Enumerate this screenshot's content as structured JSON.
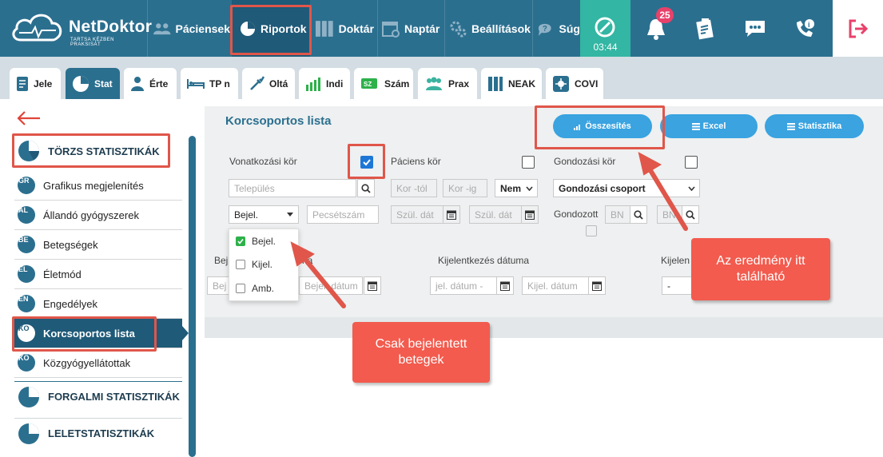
{
  "app": {
    "logo_name": "NetDoktor",
    "logo_tagline": "TARTSA KÉZBEN PRAKSISÁT"
  },
  "nav": {
    "items": [
      {
        "label": "Páciensek",
        "icon": "users-icon"
      },
      {
        "label": "Riportok",
        "icon": "pie-chart-icon"
      },
      {
        "label": "Doktár",
        "icon": "binders-icon"
      },
      {
        "label": "Naptár",
        "icon": "calendar-icon"
      },
      {
        "label": "Beállítások",
        "icon": "gears-icon"
      },
      {
        "label": "Súg",
        "icon": "help-icon"
      }
    ],
    "timer": "03:44",
    "notification_count": "25"
  },
  "tabs": [
    {
      "label": "Jele"
    },
    {
      "label": "Stat"
    },
    {
      "label": "Érte"
    },
    {
      "label": "TP n"
    },
    {
      "label": "Oltá"
    },
    {
      "label": "Indi"
    },
    {
      "label": "Szám"
    },
    {
      "label": "Prax"
    },
    {
      "label": "NEAK"
    },
    {
      "label": "COVI"
    }
  ],
  "sidebar": {
    "section_main": "TÖRZS STATISZTIKÁK",
    "items": [
      {
        "code": "GR",
        "label": "Grafikus megjelenítés"
      },
      {
        "code": "ÁL",
        "label": "Állandó gyógyszerek"
      },
      {
        "code": "BE",
        "label": "Betegségek"
      },
      {
        "code": "ÉL",
        "label": "Életmód"
      },
      {
        "code": "EN",
        "label": "Engedélyek"
      },
      {
        "code": "KO",
        "label": "Korcsoportos lista"
      },
      {
        "code": "KÖ",
        "label": "Közgyógyellátottak"
      }
    ],
    "section_2": "FORGALMI STATISZTIKÁK",
    "section_3": "LELETSTATISZTIKÁK"
  },
  "main": {
    "title": "Korcsoportos lista",
    "btn_summary": "Összesítés",
    "btn_excel": "Excel",
    "btn_stats": "Statisztika",
    "lbl_vonatkozasi": "Vonatkozási kör",
    "lbl_paciens": "Páciens kör",
    "lbl_gondozasi": "Gondozási kör",
    "ph_telepules": "Település",
    "ph_kor_tol": "Kor -tól",
    "ph_kor_ig": "Kor -ig",
    "sel_nem": "Nem",
    "sel_gondozasi_csoport": "Gondozási csoport",
    "sel_bejel": "Bejel.",
    "ph_pecsetszam": "Pecsétszám",
    "ph_szul_dat_1": "Szül. dát",
    "ph_szul_dat_2": "Szül. dát",
    "lbl_gondozott": "Gondozott",
    "ph_bn_1": "BN",
    "ph_bn_2": "BN",
    "lbl_bejel_partial": "Bej",
    "lbl_bejel_partial_2": "na",
    "lbl_kijelentkezes": "Kijelentkezés dátuma",
    "lbl_kijelen_partial": "Kijelen",
    "ph_bej_1": "Bej",
    "ph_bej_2": "Bejel. dátum",
    "ph_jel_datum": "jel. dátum -",
    "ph_kijel_datum": "Kijel. dátum",
    "sel_dash": "-",
    "dropdown": [
      {
        "label": "Bejel.",
        "checked": true
      },
      {
        "label": "Kijel.",
        "checked": false
      },
      {
        "label": "Amb.",
        "checked": false
      }
    ]
  },
  "annotations": {
    "result_here": "Az eredmény itt található",
    "only_reported": "Csak bejelentett betegek"
  }
}
